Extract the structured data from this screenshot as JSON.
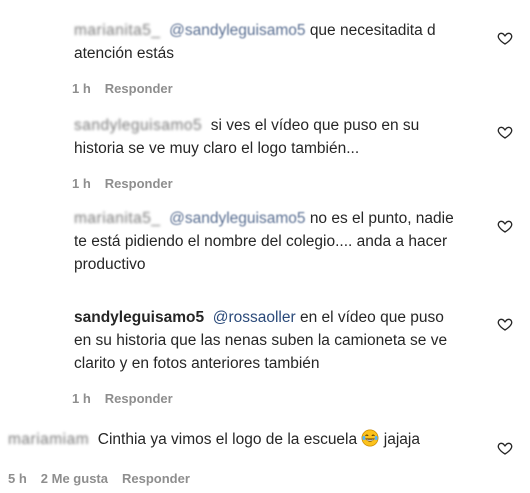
{
  "comments": [
    {
      "user": "marianita5_",
      "mention": "@sandyleguisamo5",
      "text_line1": "que necesitadita d",
      "text_line2": "atención estás",
      "time": "1 h",
      "reply_label": "Responder",
      "heart_icon": "heart-outline-icon"
    },
    {
      "user": "sandyleguisamo5",
      "mention": "",
      "text_line1": "si ves el vídeo que puso en su",
      "text_line2": "historia se ve muy claro el logo también...",
      "time": "1 h",
      "reply_label": "Responder",
      "heart_icon": "heart-outline-icon"
    },
    {
      "user": "marianita5_",
      "mention": "@sandyleguisamo5",
      "text_line1": "no es el punto, nadie",
      "text_line2": "te está pidiendo el nombre del colegio.... anda a hacer",
      "text_line3": "productivo",
      "heart_icon": "heart-outline-icon"
    },
    {
      "user": "sandyleguisamo5",
      "mention": "@rossaoller",
      "text_line1": "en el vídeo que puso",
      "text_line2": "en su historia que las nenas suben la camioneta se ve",
      "text_line3": "clarito y en fotos anteriores también",
      "time": "1 h",
      "reply_label": "Responder",
      "heart_icon": "heart-outline-icon"
    },
    {
      "user": "mariamiam",
      "text_line1": "Cinthia ya vimos el logo de la escuela",
      "emoji": "laughing-tears-emoji",
      "text_after_emoji": "jajaja",
      "time": "5 h",
      "likes": "2 Me gusta",
      "reply_label": "Responder",
      "heart_icon": "heart-outline-icon"
    }
  ]
}
